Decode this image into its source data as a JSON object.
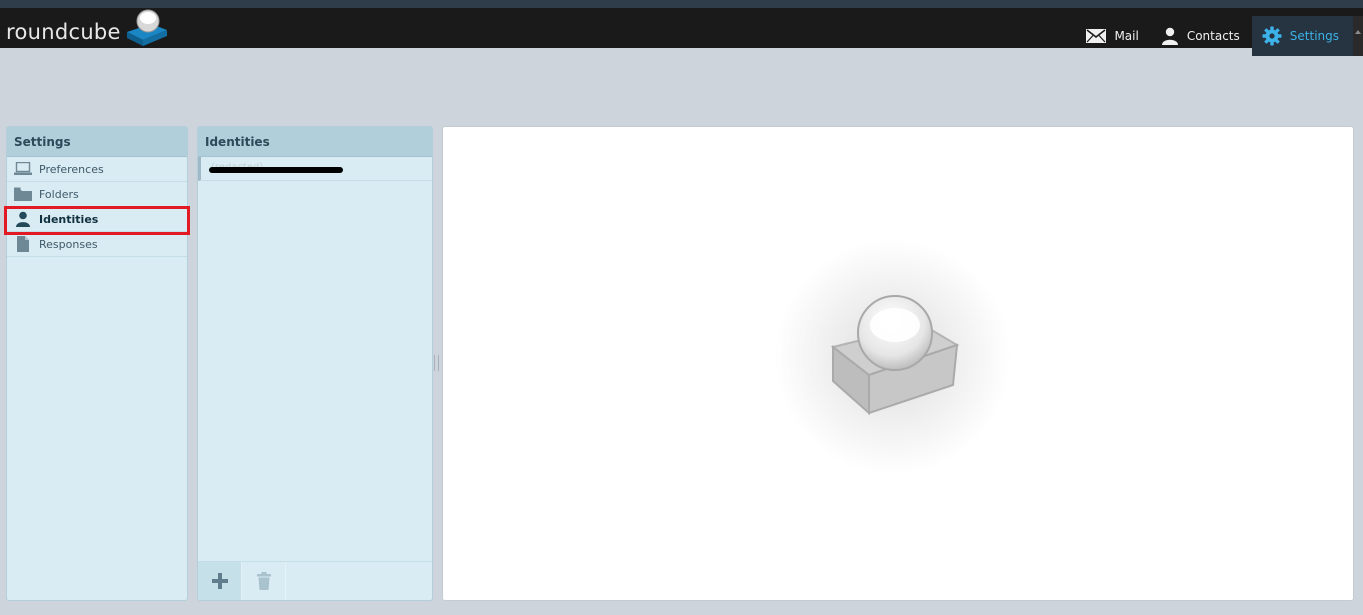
{
  "app": {
    "logo_text": "roundcube"
  },
  "topnav": {
    "items": [
      {
        "label": "Mail",
        "icon": "envelope-icon"
      },
      {
        "label": "Contacts",
        "icon": "person-icon"
      },
      {
        "label": "Settings",
        "icon": "gear-icon",
        "active": true
      }
    ]
  },
  "settings_panel": {
    "title": "Settings",
    "items": [
      {
        "label": "Preferences",
        "icon": "laptop-icon"
      },
      {
        "label": "Folders",
        "icon": "folder-icon"
      },
      {
        "label": "Identities",
        "icon": "person-icon",
        "selected": true
      },
      {
        "label": "Responses",
        "icon": "document-icon"
      }
    ]
  },
  "identities_panel": {
    "title": "Identities",
    "identities": [
      {
        "label": "(redacted)"
      }
    ],
    "footer": {
      "add_icon": "plus-icon",
      "delete_icon": "trash-icon"
    }
  },
  "colors": {
    "topbar": "#1a1a1a",
    "accent": "#3cb2e8",
    "panel": "#d9ebf3",
    "highlight": "#e21a23"
  }
}
